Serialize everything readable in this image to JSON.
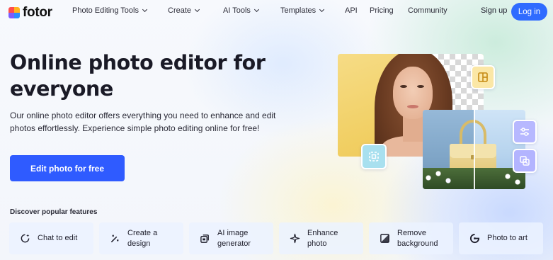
{
  "brand": {
    "name": "fotor"
  },
  "nav": {
    "items": [
      {
        "label": "Photo Editing Tools",
        "dropdown": true
      },
      {
        "label": "Create",
        "dropdown": true
      },
      {
        "label": "AI Tools",
        "dropdown": true
      },
      {
        "label": "Templates",
        "dropdown": true
      },
      {
        "label": "API",
        "dropdown": false
      },
      {
        "label": "Pricing",
        "dropdown": false
      },
      {
        "label": "Community",
        "dropdown": false
      }
    ],
    "signup": "Sign up",
    "login": "Log in"
  },
  "hero": {
    "title": "Online photo editor for everyone",
    "description": "Our online photo editor offers everything you need to enhance and edit photos effortlessly. Experience simple photo editing online for free!",
    "cta": "Edit photo for free"
  },
  "features": {
    "title": "Discover popular features",
    "items": [
      {
        "label": "Chat to edit",
        "icon": "chat-sparkle-icon"
      },
      {
        "label": "Create a\ndesign",
        "icon": "design-wand-icon"
      },
      {
        "label": "AI image\ngenerator",
        "icon": "image-layers-icon"
      },
      {
        "label": "Enhance\nphoto",
        "icon": "enhance-sparkle-icon"
      },
      {
        "label": "Remove\nbackground",
        "icon": "remove-background-icon"
      },
      {
        "label": "Photo to art",
        "icon": "photo-art-icon"
      }
    ]
  },
  "colors": {
    "accent": "#2f5bff",
    "login_bg": "#2f6bff",
    "feature_card_bg": "#ebf2ff"
  }
}
